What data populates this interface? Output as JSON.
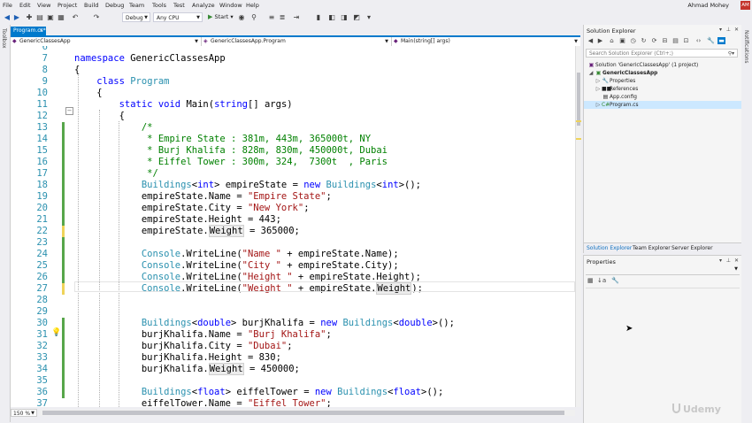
{
  "menu": [
    "File",
    "Edit",
    "View",
    "Project",
    "Build",
    "Debug",
    "Team",
    "Tools",
    "Test",
    "Analyze",
    "Window",
    "Help"
  ],
  "user": {
    "name": "Ahmad Mohey",
    "initials": "AM"
  },
  "toolbar": {
    "config": "Debug",
    "platform": "Any CPU",
    "start_label": "Start"
  },
  "sidebars": {
    "toolbox": "Toolbox",
    "notifications": "Notifications"
  },
  "tab": {
    "title": "Program.cs*",
    "close": "×"
  },
  "nav": {
    "project": "GenericClassesApp",
    "class": "GenericClassesApp.Program",
    "member": "Main(string[] args)"
  },
  "zoom": "150 %",
  "code_lines": [
    {
      "n": "6",
      "t": ""
    },
    {
      "n": "7",
      "t": "namespace GenericClassesApp"
    },
    {
      "n": "8",
      "t": "{"
    },
    {
      "n": "9",
      "t": "    class Program"
    },
    {
      "n": "10",
      "t": "    {"
    },
    {
      "n": "11",
      "t": "        static void Main(string[] args)"
    },
    {
      "n": "12",
      "t": "        {"
    },
    {
      "n": "13",
      "t": "            /*"
    },
    {
      "n": "14",
      "t": "             * Empire State : 381m, 443m, 365000t, NY"
    },
    {
      "n": "15",
      "t": "             * Burj Khalifa : 828m, 830m, 450000t, Dubai"
    },
    {
      "n": "16",
      "t": "             * Eiffel Tower : 300m, 324,  7300t  , Paris"
    },
    {
      "n": "17",
      "t": "             */"
    },
    {
      "n": "18",
      "t": "            Buildings<int> empireState = new Buildings<int>();"
    },
    {
      "n": "19",
      "t": "            empireState.Name = \"Empire State\";"
    },
    {
      "n": "20",
      "t": "            empireState.City = \"New York\";"
    },
    {
      "n": "21",
      "t": "            empireState.Height = 443;"
    },
    {
      "n": "22",
      "t": "            empireState.Weight = 365000;"
    },
    {
      "n": "23",
      "t": ""
    },
    {
      "n": "24",
      "t": "            Console.WriteLine(\"Name \" + empireState.Name);"
    },
    {
      "n": "25",
      "t": "            Console.WriteLine(\"City \" + empireState.City);"
    },
    {
      "n": "26",
      "t": "            Console.WriteLine(\"Height \" + empireState.Height);"
    },
    {
      "n": "27",
      "t": "            Console.WriteLine(\"Weight \" + empireState.Weight);"
    },
    {
      "n": "28",
      "t": ""
    },
    {
      "n": "29",
      "t": ""
    },
    {
      "n": "30",
      "t": "            Buildings<double> burjKhalifa = new Buildings<double>();"
    },
    {
      "n": "31",
      "t": "            burjKhalifa.Name = \"Burj Khalifa\";"
    },
    {
      "n": "32",
      "t": "            burjKhalifa.City = \"Dubai\";"
    },
    {
      "n": "33",
      "t": "            burjKhalifa.Height = 830;"
    },
    {
      "n": "34",
      "t": "            burjKhalifa.Weight = 450000;"
    },
    {
      "n": "35",
      "t": ""
    },
    {
      "n": "36",
      "t": "            Buildings<float> eiffelTower = new Buildings<float>();"
    },
    {
      "n": "37",
      "t": "            eiffelTower.Name = \"Eiffel Tower\";"
    }
  ],
  "solution": {
    "title": "Solution Explorer",
    "search_placeholder": "Search Solution Explorer (Ctrl+;)",
    "items": [
      {
        "label": "Solution 'GenericClassesApp' (1 project)",
        "icon": "solution-icon"
      },
      {
        "label": "GenericClassesApp",
        "icon": "csharp-project-icon"
      },
      {
        "label": "Properties",
        "icon": "wrench-icon"
      },
      {
        "label": "References",
        "icon": "references-icon"
      },
      {
        "label": "App.config",
        "icon": "config-file-icon"
      },
      {
        "label": "Program.cs",
        "icon": "csharp-file-icon"
      }
    ],
    "tabs": [
      "Solution Explorer",
      "Team Explorer",
      "Server Explorer"
    ]
  },
  "properties": {
    "title": "Properties"
  },
  "watermark": "Udemy",
  "colors": {
    "accent": "#007acc",
    "keyword": "#0000ff",
    "type": "#2b91af",
    "string": "#a31515",
    "comment": "#008000"
  }
}
